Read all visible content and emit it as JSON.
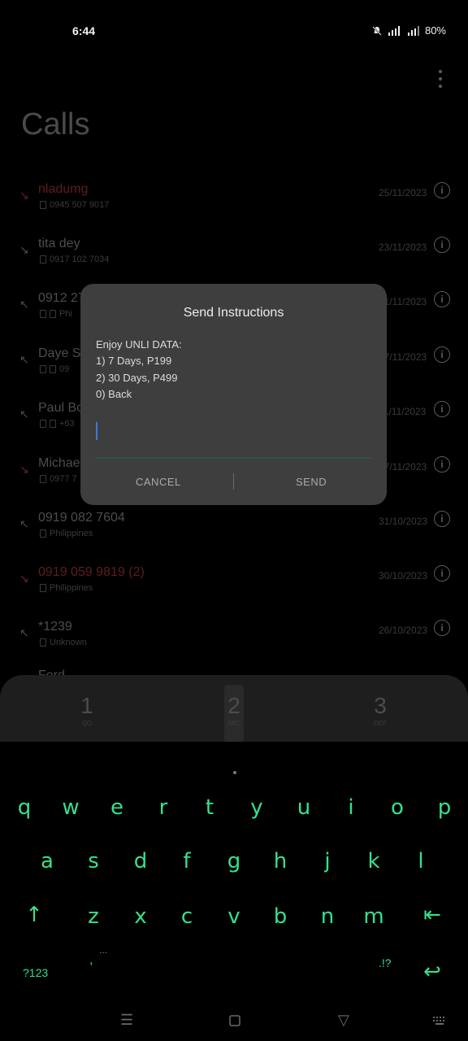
{
  "status_bar": {
    "time": "6:44",
    "battery": "80%",
    "icons": [
      "silent-bell-icon",
      "signal-icon",
      "signal-icon",
      "battery-text"
    ]
  },
  "calls": {
    "title": "Calls",
    "rows": [
      {
        "name": "nladumg",
        "sub": "0945 507 9017",
        "date": "25/11/2023",
        "type": "missed"
      },
      {
        "name": "tita dey",
        "sub": "0917 102 7034",
        "date": "23/11/2023",
        "type": "incoming"
      },
      {
        "name": "0912 27",
        "sub": "Phi",
        "date": "21/11/2023",
        "type": "outgoing"
      },
      {
        "name": "Daye Sa",
        "sub": "09",
        "date": "17/11/2023",
        "type": "outgoing"
      },
      {
        "name": "Paul Bo",
        "sub": "+63",
        "date": "11/11/2023",
        "type": "outgoing"
      },
      {
        "name": "Michael",
        "sub": "0977 7",
        "date": "07/11/2023",
        "type": "missed"
      },
      {
        "name": "0919 082 7604",
        "sub": "Philippines",
        "date": "31/10/2023",
        "type": "outgoing"
      },
      {
        "name": "0919 059 9819 (2)",
        "sub": "Philippines",
        "date": "30/10/2023",
        "type": "missed"
      },
      {
        "name": "*1239",
        "sub": "Unknown",
        "date": "26/10/2023",
        "type": "outgoing"
      },
      {
        "name": "Ford",
        "sub": "",
        "date": "",
        "type": "outgoing"
      }
    ]
  },
  "dialpad": {
    "keys": [
      {
        "num": "1",
        "letters": "QO"
      },
      {
        "num": "2",
        "letters": "ABC"
      },
      {
        "num": "3",
        "letters": "DEF"
      }
    ]
  },
  "dialog": {
    "title": "Send Instructions",
    "lines": [
      "Enjoy UNLI DATA:",
      "1) 7 Days, P199",
      "2) 30 Days, P499",
      "0) Back"
    ],
    "input_value": "",
    "cancel_label": "CANCEL",
    "send_label": "SEND",
    "accent": "#3d7bd8"
  },
  "keyboard": {
    "row1": [
      "q",
      "w",
      "e",
      "r",
      "t",
      "y",
      "u",
      "i",
      "o",
      "p"
    ],
    "row2": [
      "a",
      "s",
      "d",
      "f",
      "g",
      "h",
      "j",
      "k",
      "l"
    ],
    "row3": [
      "z",
      "x",
      "c",
      "v",
      "b",
      "n",
      "m"
    ],
    "shift": "↑",
    "backspace": "⇤",
    "sym_label": "?123",
    "comma": ",",
    "period_symbols": ".!?",
    "enter": "↩",
    "key_color": "#36e08c"
  },
  "nav_bar": {
    "items": [
      "menu-icon",
      "home-icon",
      "back-icon",
      "keyboard-icon"
    ]
  }
}
